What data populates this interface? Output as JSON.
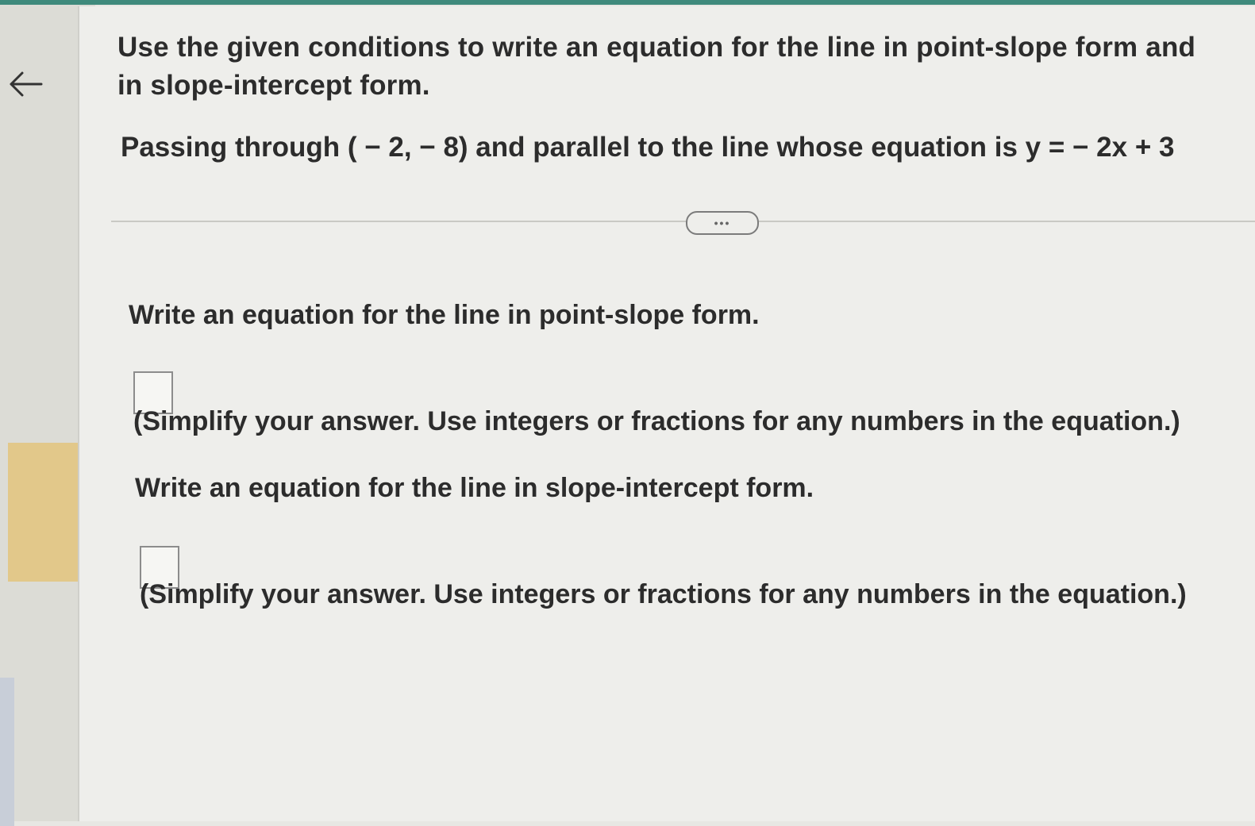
{
  "header": {
    "back_icon": "back-arrow-icon"
  },
  "question": {
    "instruction_line1": "Use the given conditions to write an equation for the line in point-slope form and",
    "instruction_line2": "in slope-intercept form.",
    "condition": "Passing through ( − 2, − 8) and parallel to the line whose equation is y =  − 2x + 3"
  },
  "toolbar": {
    "more_label": "•••"
  },
  "part1": {
    "prompt": "Write an equation for the line in point-slope form.",
    "answer_value": "",
    "hint": "(Simplify your answer. Use integers or fractions for any numbers in the equation.)"
  },
  "part2": {
    "prompt": "Write an equation for the line in slope-intercept form.",
    "answer_value": "",
    "hint": "(Simplify your answer. Use integers or fractions for any numbers in the equation.)"
  },
  "colors": {
    "accent_strip": "#3f8a7c",
    "rail_highlight": "#e2c88a"
  }
}
